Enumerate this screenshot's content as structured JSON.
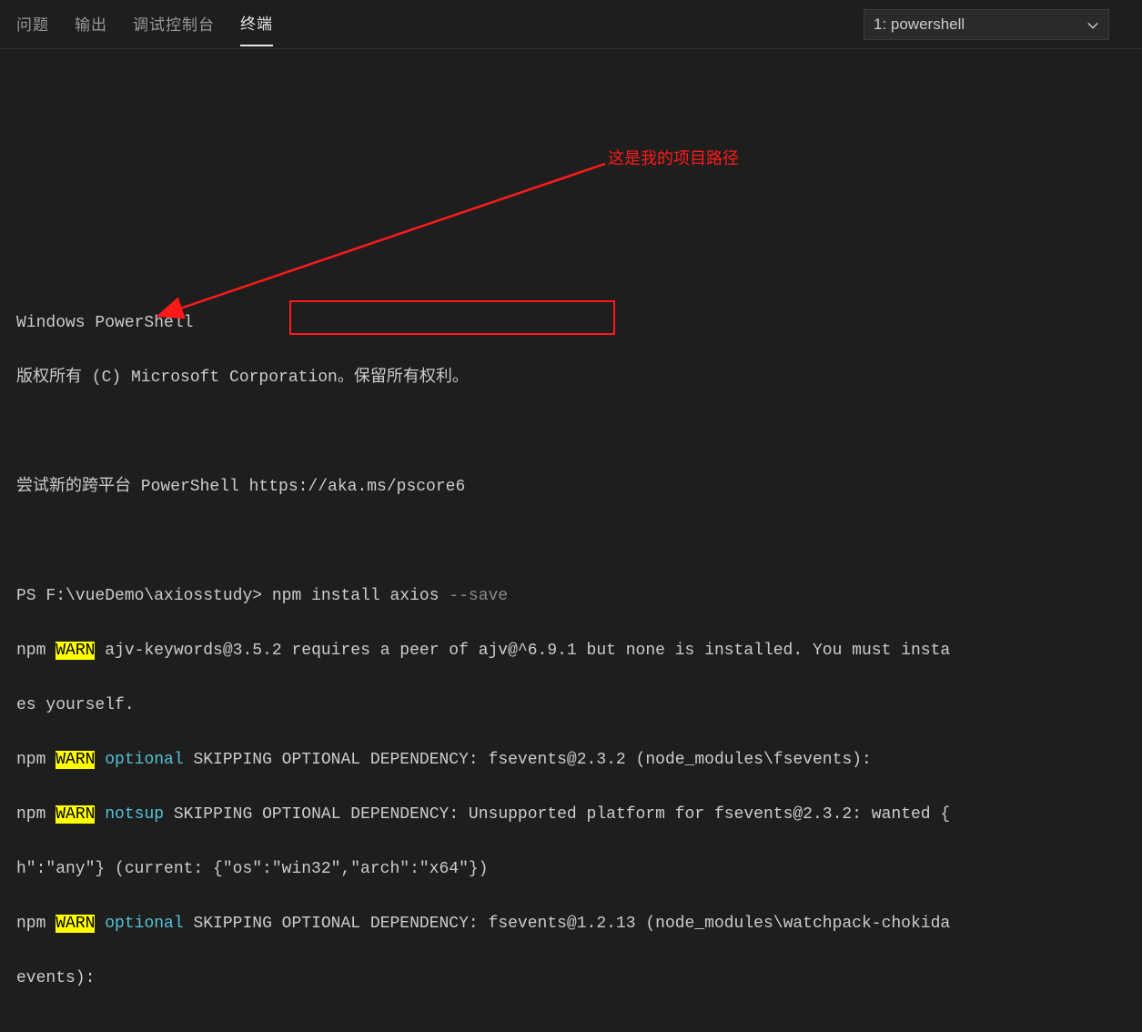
{
  "header": {
    "tabs": [
      {
        "label": "问题",
        "active": false
      },
      {
        "label": "输出",
        "active": false
      },
      {
        "label": "调试控制台",
        "active": false
      },
      {
        "label": "终端",
        "active": true
      }
    ],
    "selector_value": "1: powershell"
  },
  "annotation": {
    "label": "这是我的项目路径"
  },
  "terminal": {
    "line1": "Windows PowerShell",
    "line2": "版权所有 (C) Microsoft Corporation。保留所有权利。",
    "line3": "尝试新的跨平台 PowerShell https://aka.ms/pscore6",
    "prompt": "PS F:\\vueDemo\\axiosstudy> ",
    "command_main": "npm install axios ",
    "command_flag": "--save",
    "warn_lines": {
      "w1_a": "npm ",
      "w1_warn": "WARN",
      "w1_b": " ajv-keywords@3.5.2 requires a peer of ajv@^6.9.1 but none is installed. You must insta",
      "w1_c": "es yourself.",
      "w2_a": "npm ",
      "w2_warn": "WARN",
      "w2_opt": " optional",
      "w2_b": " SKIPPING OPTIONAL DEPENDENCY: fsevents@2.3.2 (node_modules\\fsevents):",
      "w3_a": "npm ",
      "w3_warn": "WARN",
      "w3_opt": " notsup",
      "w3_b": " SKIPPING OPTIONAL DEPENDENCY: Unsupported platform for fsevents@2.3.2: wanted {",
      "w3_c": "h\":\"any\"} (current: {\"os\":\"win32\",\"arch\":\"x64\"})",
      "w4_a": "npm ",
      "w4_warn": "WARN",
      "w4_opt": " optional",
      "w4_b": " SKIPPING OPTIONAL DEPENDENCY: fsevents@1.2.13 (node_modules\\watchpack-chokida",
      "w4_c": "events):"
    }
  }
}
